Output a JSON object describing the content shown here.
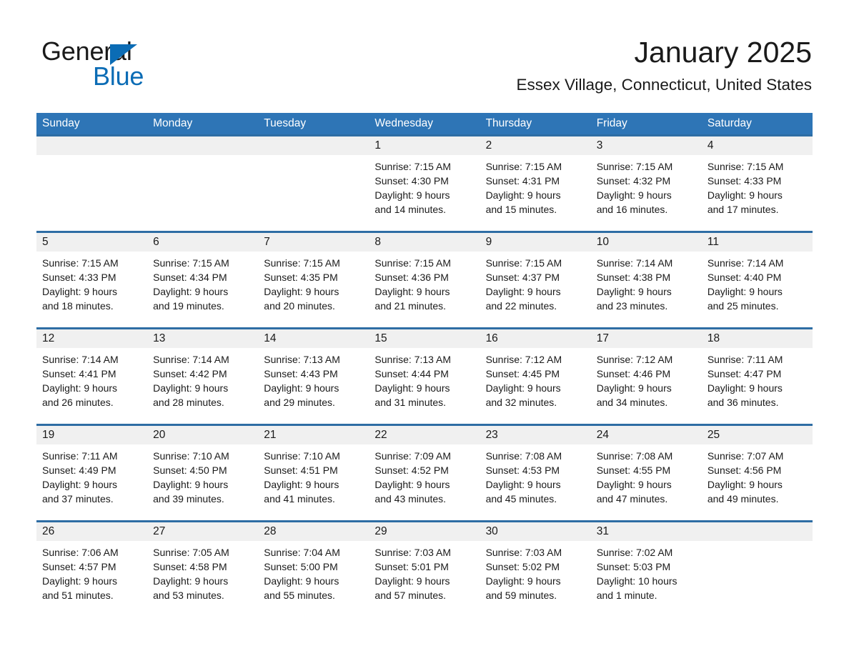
{
  "brand": {
    "name_part1": "General",
    "name_part2": "Blue",
    "triangle_color": "#0b6cb5",
    "accent_color": "#2e75b6"
  },
  "header": {
    "month_title": "January 2025",
    "location": "Essex Village, Connecticut, United States"
  },
  "weekday_headers": [
    "Sunday",
    "Monday",
    "Tuesday",
    "Wednesday",
    "Thursday",
    "Friday",
    "Saturday"
  ],
  "weeks": [
    {
      "days": [
        {
          "date": "",
          "lines": []
        },
        {
          "date": "",
          "lines": []
        },
        {
          "date": "",
          "lines": []
        },
        {
          "date": "1",
          "lines": [
            "Sunrise: 7:15 AM",
            "Sunset: 4:30 PM",
            "Daylight: 9 hours",
            "and 14 minutes."
          ]
        },
        {
          "date": "2",
          "lines": [
            "Sunrise: 7:15 AM",
            "Sunset: 4:31 PM",
            "Daylight: 9 hours",
            "and 15 minutes."
          ]
        },
        {
          "date": "3",
          "lines": [
            "Sunrise: 7:15 AM",
            "Sunset: 4:32 PM",
            "Daylight: 9 hours",
            "and 16 minutes."
          ]
        },
        {
          "date": "4",
          "lines": [
            "Sunrise: 7:15 AM",
            "Sunset: 4:33 PM",
            "Daylight: 9 hours",
            "and 17 minutes."
          ]
        }
      ]
    },
    {
      "days": [
        {
          "date": "5",
          "lines": [
            "Sunrise: 7:15 AM",
            "Sunset: 4:33 PM",
            "Daylight: 9 hours",
            "and 18 minutes."
          ]
        },
        {
          "date": "6",
          "lines": [
            "Sunrise: 7:15 AM",
            "Sunset: 4:34 PM",
            "Daylight: 9 hours",
            "and 19 minutes."
          ]
        },
        {
          "date": "7",
          "lines": [
            "Sunrise: 7:15 AM",
            "Sunset: 4:35 PM",
            "Daylight: 9 hours",
            "and 20 minutes."
          ]
        },
        {
          "date": "8",
          "lines": [
            "Sunrise: 7:15 AM",
            "Sunset: 4:36 PM",
            "Daylight: 9 hours",
            "and 21 minutes."
          ]
        },
        {
          "date": "9",
          "lines": [
            "Sunrise: 7:15 AM",
            "Sunset: 4:37 PM",
            "Daylight: 9 hours",
            "and 22 minutes."
          ]
        },
        {
          "date": "10",
          "lines": [
            "Sunrise: 7:14 AM",
            "Sunset: 4:38 PM",
            "Daylight: 9 hours",
            "and 23 minutes."
          ]
        },
        {
          "date": "11",
          "lines": [
            "Sunrise: 7:14 AM",
            "Sunset: 4:40 PM",
            "Daylight: 9 hours",
            "and 25 minutes."
          ]
        }
      ]
    },
    {
      "days": [
        {
          "date": "12",
          "lines": [
            "Sunrise: 7:14 AM",
            "Sunset: 4:41 PM",
            "Daylight: 9 hours",
            "and 26 minutes."
          ]
        },
        {
          "date": "13",
          "lines": [
            "Sunrise: 7:14 AM",
            "Sunset: 4:42 PM",
            "Daylight: 9 hours",
            "and 28 minutes."
          ]
        },
        {
          "date": "14",
          "lines": [
            "Sunrise: 7:13 AM",
            "Sunset: 4:43 PM",
            "Daylight: 9 hours",
            "and 29 minutes."
          ]
        },
        {
          "date": "15",
          "lines": [
            "Sunrise: 7:13 AM",
            "Sunset: 4:44 PM",
            "Daylight: 9 hours",
            "and 31 minutes."
          ]
        },
        {
          "date": "16",
          "lines": [
            "Sunrise: 7:12 AM",
            "Sunset: 4:45 PM",
            "Daylight: 9 hours",
            "and 32 minutes."
          ]
        },
        {
          "date": "17",
          "lines": [
            "Sunrise: 7:12 AM",
            "Sunset: 4:46 PM",
            "Daylight: 9 hours",
            "and 34 minutes."
          ]
        },
        {
          "date": "18",
          "lines": [
            "Sunrise: 7:11 AM",
            "Sunset: 4:47 PM",
            "Daylight: 9 hours",
            "and 36 minutes."
          ]
        }
      ]
    },
    {
      "days": [
        {
          "date": "19",
          "lines": [
            "Sunrise: 7:11 AM",
            "Sunset: 4:49 PM",
            "Daylight: 9 hours",
            "and 37 minutes."
          ]
        },
        {
          "date": "20",
          "lines": [
            "Sunrise: 7:10 AM",
            "Sunset: 4:50 PM",
            "Daylight: 9 hours",
            "and 39 minutes."
          ]
        },
        {
          "date": "21",
          "lines": [
            "Sunrise: 7:10 AM",
            "Sunset: 4:51 PM",
            "Daylight: 9 hours",
            "and 41 minutes."
          ]
        },
        {
          "date": "22",
          "lines": [
            "Sunrise: 7:09 AM",
            "Sunset: 4:52 PM",
            "Daylight: 9 hours",
            "and 43 minutes."
          ]
        },
        {
          "date": "23",
          "lines": [
            "Sunrise: 7:08 AM",
            "Sunset: 4:53 PM",
            "Daylight: 9 hours",
            "and 45 minutes."
          ]
        },
        {
          "date": "24",
          "lines": [
            "Sunrise: 7:08 AM",
            "Sunset: 4:55 PM",
            "Daylight: 9 hours",
            "and 47 minutes."
          ]
        },
        {
          "date": "25",
          "lines": [
            "Sunrise: 7:07 AM",
            "Sunset: 4:56 PM",
            "Daylight: 9 hours",
            "and 49 minutes."
          ]
        }
      ]
    },
    {
      "days": [
        {
          "date": "26",
          "lines": [
            "Sunrise: 7:06 AM",
            "Sunset: 4:57 PM",
            "Daylight: 9 hours",
            "and 51 minutes."
          ]
        },
        {
          "date": "27",
          "lines": [
            "Sunrise: 7:05 AM",
            "Sunset: 4:58 PM",
            "Daylight: 9 hours",
            "and 53 minutes."
          ]
        },
        {
          "date": "28",
          "lines": [
            "Sunrise: 7:04 AM",
            "Sunset: 5:00 PM",
            "Daylight: 9 hours",
            "and 55 minutes."
          ]
        },
        {
          "date": "29",
          "lines": [
            "Sunrise: 7:03 AM",
            "Sunset: 5:01 PM",
            "Daylight: 9 hours",
            "and 57 minutes."
          ]
        },
        {
          "date": "30",
          "lines": [
            "Sunrise: 7:03 AM",
            "Sunset: 5:02 PM",
            "Daylight: 9 hours",
            "and 59 minutes."
          ]
        },
        {
          "date": "31",
          "lines": [
            "Sunrise: 7:02 AM",
            "Sunset: 5:03 PM",
            "Daylight: 10 hours",
            "and 1 minute."
          ]
        },
        {
          "date": "",
          "lines": []
        }
      ]
    }
  ]
}
